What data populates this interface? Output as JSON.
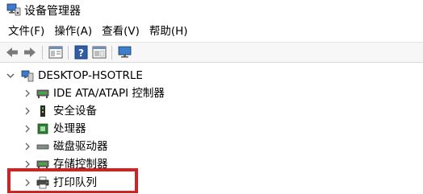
{
  "window": {
    "title": "设备管理器"
  },
  "menu": [
    {
      "label": "文件(F)"
    },
    {
      "label": "操作(A)"
    },
    {
      "label": "查看(V)"
    },
    {
      "label": "帮助(H)"
    }
  ],
  "toolbar": {
    "buttons": [
      "back-icon",
      "forward-icon",
      "properties-pane-icon",
      "help-icon",
      "view-pane-icon",
      "monitor-scan-icon"
    ]
  },
  "tree": {
    "root": {
      "label": "DESKTOP-HSOTRLE",
      "expanded": true
    },
    "children": [
      {
        "label": "IDE ATA/ATAPI 控制器",
        "icon": "ide-controller-icon"
      },
      {
        "label": "安全设备",
        "icon": "security-device-icon"
      },
      {
        "label": "处理器",
        "icon": "processor-icon"
      },
      {
        "label": "磁盘驱动器",
        "icon": "disk-drive-icon"
      },
      {
        "label": "存储控制器",
        "icon": "storage-controller-icon"
      },
      {
        "label": "打印队列",
        "icon": "printer-icon"
      }
    ]
  },
  "highlight_color": "#d42020"
}
